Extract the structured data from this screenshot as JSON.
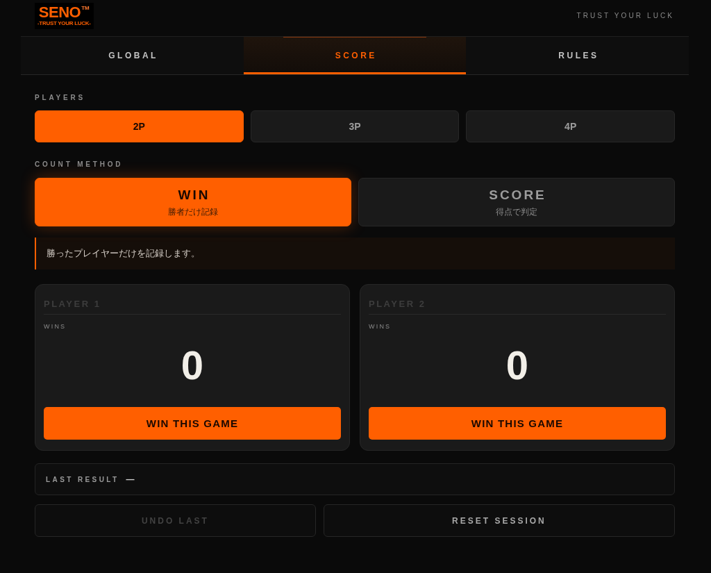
{
  "header": {
    "logo": {
      "wordmark": "SENO",
      "trademark": "TM",
      "tagline": "-TRUST YOUR LUCK-"
    },
    "tagline": "TRUST YOUR LUCK"
  },
  "tabs": [
    {
      "label": "GLOBAL",
      "selected": false
    },
    {
      "label": "SCORE",
      "selected": true
    },
    {
      "label": "RULES",
      "selected": false
    }
  ],
  "players": {
    "label": "PLAYERS",
    "options": [
      {
        "label": "2P",
        "selected": true
      },
      {
        "label": "3P",
        "selected": false
      },
      {
        "label": "4P",
        "selected": false
      }
    ]
  },
  "count_method": {
    "label": "COUNT METHOD",
    "options": [
      {
        "title": "WIN",
        "subtitle": "勝者だけ記録",
        "selected": true
      },
      {
        "title": "SCORE",
        "subtitle": "得点で判定",
        "selected": false
      }
    ]
  },
  "info": {
    "text": "勝ったプレイヤーだけを記録します。"
  },
  "player_cards": [
    {
      "name": "PLAYER 1",
      "stat_label": "WINS",
      "value": "0",
      "button": "WIN THIS GAME"
    },
    {
      "name": "PLAYER 2",
      "stat_label": "WINS",
      "value": "0",
      "button": "WIN THIS GAME"
    }
  ],
  "last_result": {
    "label": "LAST RESULT",
    "value": "—"
  },
  "actions": [
    {
      "label": "UNDO LAST",
      "disabled": true
    },
    {
      "label": "RESET SESSION",
      "disabled": false
    }
  ]
}
